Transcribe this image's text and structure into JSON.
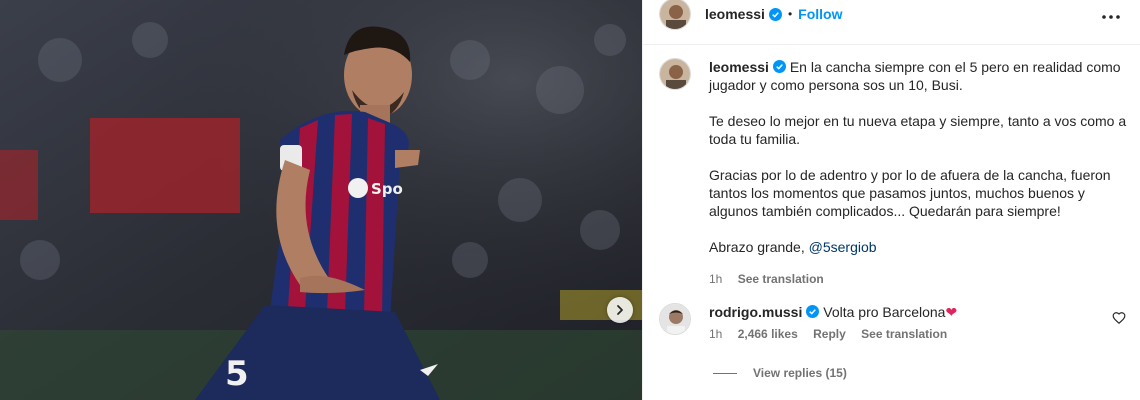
{
  "post": {
    "username": "leomessi",
    "follow_label": "Follow",
    "separator": "•"
  },
  "caption": {
    "username": "leomessi",
    "paragraph1": "En la cancha siempre con el 5 pero en realidad como jugador y como persona sos un 10, Busi.",
    "paragraph2": "Te deseo lo mejor en tu nueva etapa y siempre, tanto a vos como a toda tu familia.",
    "paragraph3": "Gracias por lo de adentro y por lo de afuera de la cancha, fueron tantos los momentos que pasamos juntos, muchos buenos y algunos también complicados... Quedarán para siempre!",
    "paragraph4_prefix": "Abrazo grande, ",
    "mention": "@5sergiob",
    "time": "1h",
    "see_translation": "See translation"
  },
  "comment": {
    "username": "rodrigo.mussi",
    "text": "Volta pro Barcelona",
    "emoji": "❤",
    "time": "1h",
    "likes": "2,466 likes",
    "reply": "Reply",
    "see_translation": "See translation",
    "view_replies": "View replies (15)"
  },
  "colors": {
    "accent": "#0095f6",
    "verified": "#0095f6",
    "heart": "#e0245e"
  },
  "icons": {
    "verified": "verified-badge-icon",
    "more": "more-options-icon",
    "next": "chevron-right-icon",
    "like": "heart-outline-icon"
  }
}
